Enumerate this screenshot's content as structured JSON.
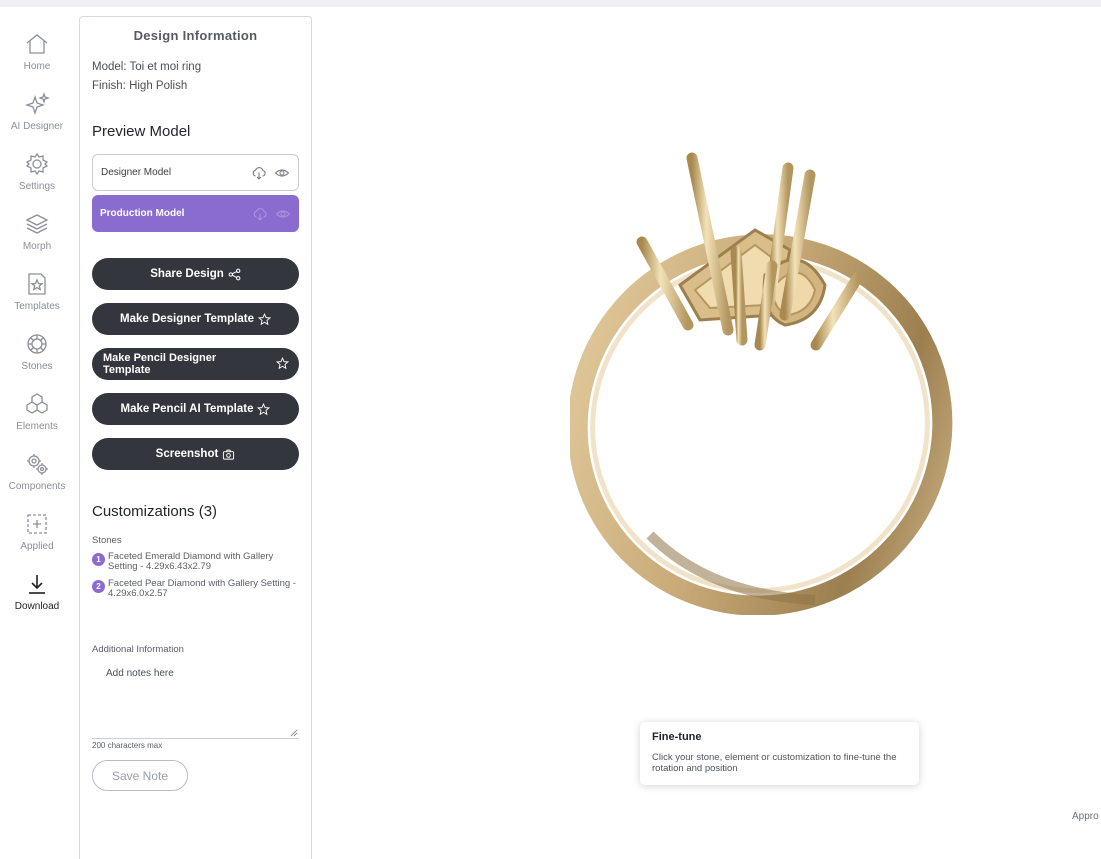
{
  "nav": {
    "home": "Home",
    "ai_designer": "AI Designer",
    "settings": "Settings",
    "morph": "Morph",
    "templates": "Templates",
    "stones": "Stones",
    "elements": "Elements",
    "components": "Components",
    "applied": "Applied",
    "download": "Download"
  },
  "panel": {
    "title": "Design Information",
    "model_line": "Model: Toi et moi ring",
    "finish_line": "Finish: High Polish",
    "preview_title": "Preview Model",
    "designer_model": "Designer Model",
    "production_model": "Production Model",
    "buttons": {
      "share": "Share Design",
      "designer_template": "Make Designer Template",
      "pencil_designer_template": "Make Pencil Designer Template",
      "pencil_ai_template": "Make Pencil AI Template",
      "screenshot": "Screenshot"
    },
    "customizations_title": "Customizations (3)",
    "stones_label": "Stones",
    "stones": [
      {
        "num": "1",
        "text": "Faceted Emerald Diamond with Gallery Setting - 4.29x6.43x2.79"
      },
      {
        "num": "2",
        "text": "Faceted Pear Diamond with Gallery Setting - 4.29x6.0x2.57"
      }
    ],
    "additional_label": "Additional Information",
    "notes_placeholder": "Add notes here",
    "char_limit": "200 characters max",
    "save_note": "Save Note"
  },
  "viewer": {
    "tooltip_title": "Fine-tune",
    "tooltip_text": "Click your stone, element or customization to fine-tune the rotation and position",
    "approx_label": "Appro"
  },
  "colors": {
    "accent_purple": "#8a6cd1",
    "button_dark": "#33373d",
    "ring_gold": "#c9ad7c"
  }
}
